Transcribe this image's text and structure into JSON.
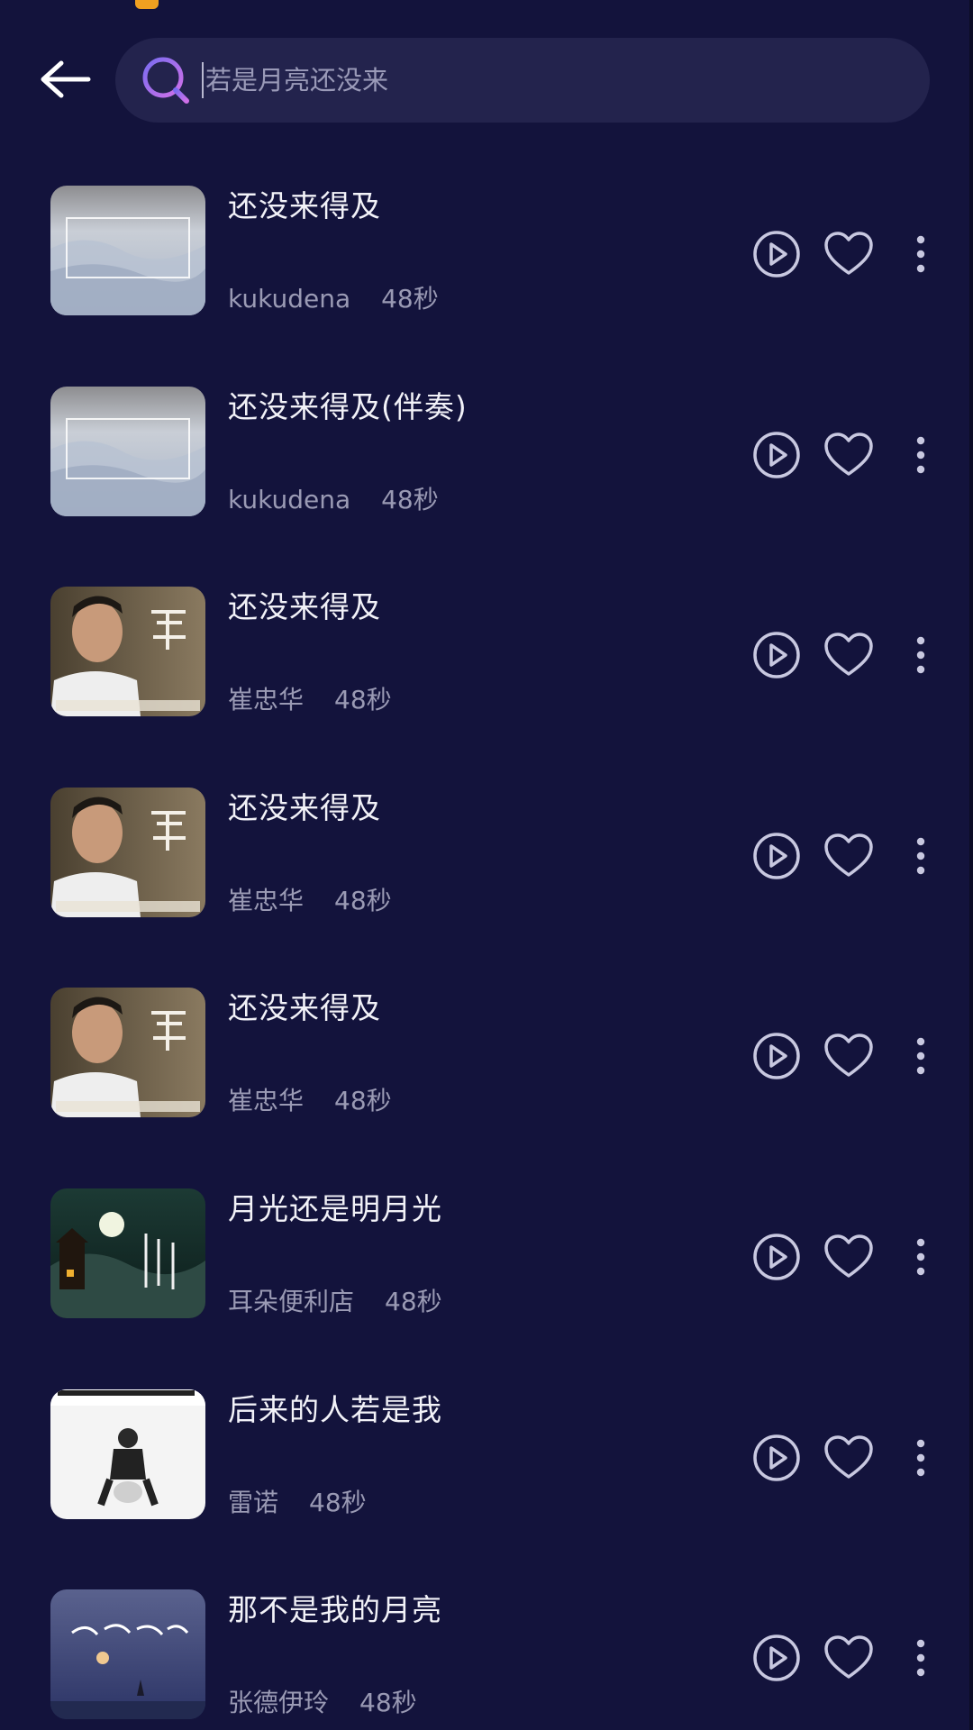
{
  "search": {
    "placeholder": "若是月亮还没来",
    "value": ""
  },
  "icons": {
    "back": "arrow-left-icon",
    "search": "search-icon",
    "play": "play-circle-icon",
    "like": "heart-outline-icon",
    "more": "more-vertical-icon"
  },
  "colors": {
    "background": "#13133c",
    "search_bg": "#23234d",
    "search_icon": "#b070f0",
    "title": "#f2f2f8",
    "meta": "#9a9ab4",
    "action_icon": "#c8c8e0"
  },
  "songs": [
    {
      "title": "还没来得及",
      "artist": "kukudena",
      "duration": "48秒",
      "cover": "landscape-grey"
    },
    {
      "title": "还没来得及(伴奏)",
      "artist": "kukudena",
      "duration": "48秒",
      "cover": "landscape-grey"
    },
    {
      "title": "还没来得及",
      "artist": "崔忠华",
      "duration": "48秒",
      "cover": "portrait-man"
    },
    {
      "title": "还没来得及",
      "artist": "崔忠华",
      "duration": "48秒",
      "cover": "portrait-man"
    },
    {
      "title": "还没来得及",
      "artist": "崔忠华",
      "duration": "48秒",
      "cover": "portrait-man"
    },
    {
      "title": "月光还是明月光",
      "artist": "耳朵便利店",
      "duration": "48秒",
      "cover": "moon-night"
    },
    {
      "title": "后来的人若是我",
      "artist": "雷诺",
      "duration": "48秒",
      "cover": "white-figure"
    },
    {
      "title": "那不是我的月亮",
      "artist": "张德伊玲",
      "duration": "48秒",
      "cover": "blue-night"
    }
  ]
}
